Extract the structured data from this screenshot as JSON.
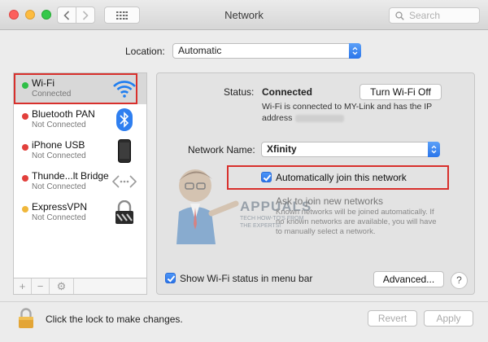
{
  "window": {
    "title": "Network"
  },
  "toolbar": {
    "search_placeholder": "Search"
  },
  "location": {
    "label": "Location:",
    "value": "Automatic"
  },
  "services": [
    {
      "name": "Wi-Fi",
      "status": "Connected",
      "status_color": "#2fbf47",
      "icon": "wifi-icon",
      "selected": true
    },
    {
      "name": "Bluetooth PAN",
      "status": "Not Connected",
      "status_color": "#e2403c",
      "icon": "bluetooth-icon"
    },
    {
      "name": "iPhone USB",
      "status": "Not Connected",
      "status_color": "#e2403c",
      "icon": "iphone-icon"
    },
    {
      "name": "Thunde...lt Bridge",
      "status": "Not Connected",
      "status_color": "#e2403c",
      "icon": "thunderbolt-bridge-icon"
    },
    {
      "name": "ExpressVPN",
      "status": "Not Connected",
      "status_color": "#f0b73a",
      "icon": "vpn-lock-icon"
    }
  ],
  "sidebar_controls": {
    "add": "+",
    "remove": "−",
    "action": "⚙"
  },
  "detail": {
    "status_label": "Status:",
    "status_value": "Connected",
    "turn_off_label": "Turn Wi-Fi Off",
    "status_description": "Wi-Fi is connected to MY-Link and has the IP address",
    "network_name_label": "Network Name:",
    "network_name_value": "Xfinity",
    "auto_join_label": "Automatically join this network",
    "ask_join_label": "Ask to join new networks",
    "ask_join_description": "Known networks will be joined automatically. If no known networks are available, you will have to manually select a network.",
    "show_status_label": "Show Wi-Fi status in menu bar",
    "advanced_label": "Advanced...",
    "help_label": "?"
  },
  "watermark": {
    "brand": "APPUALS",
    "tagline_1": "TECH HOW-TO'S FROM",
    "tagline_2": "THE EXPERTS!"
  },
  "footer": {
    "lock_text": "Click the lock to make changes.",
    "revert_label": "Revert",
    "apply_label": "Apply"
  },
  "colors": {
    "accent": "#2a75ea",
    "highlight": "#d8302c",
    "connected": "#2fbf47",
    "disconnected": "#e2403c"
  }
}
